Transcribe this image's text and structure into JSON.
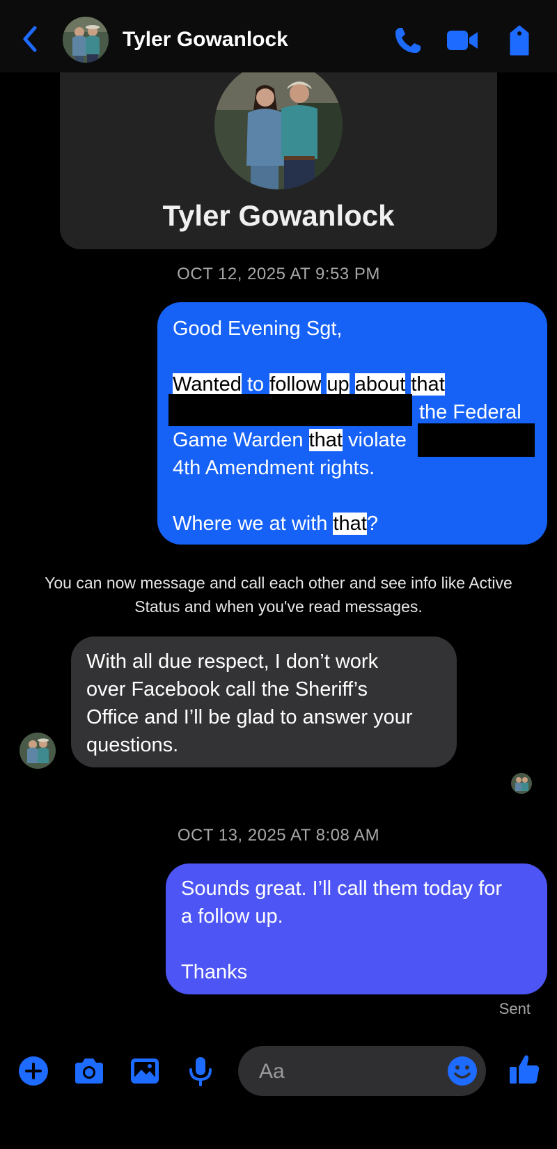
{
  "header": {
    "contact_name": "Tyler Gowanlock",
    "icons": [
      "back-chevron-icon",
      "phone-icon",
      "video-camera-icon",
      "tag-icon"
    ]
  },
  "profile": {
    "name": "Tyler Gowanlock"
  },
  "conversation": {
    "timestamp1": "OCT 12, 2025 AT 9:53 PM",
    "message1": {
      "greeting": "Good Evening Sgt,",
      "l2": [
        "Wanted",
        "to",
        "follow",
        "up",
        "about",
        "that"
      ],
      "l3_visible": "the Federal",
      "l4_a": "Game Warden",
      "l4_hl": "that",
      "l4_b": "violate",
      "l5": "4th Amendment rights.",
      "l6_a": "Where we at with",
      "l6_hl": "that",
      "l6_b": "?"
    },
    "info_line1": "You can now message and call each other and see info like Active",
    "info_line2": "Status and when you've read messages.",
    "message2": {
      "l1": "With all due respect, I don’t work",
      "l2": "over Facebook call the Sheriff’s",
      "l3": "Office and I’ll be glad to answer your",
      "l4": "questions."
    },
    "timestamp2": "OCT 13, 2025 AT 8:08 AM",
    "message3": {
      "l1": "Sounds great. I’ll call them today for",
      "l2": "a follow up.",
      "l3": "Thanks"
    },
    "status": "Sent"
  },
  "composer": {
    "placeholder": "Aa",
    "icons": [
      "plus-icon",
      "camera-icon",
      "gallery-icon",
      "microphone-icon",
      "emoji-icon",
      "thumbs-up-icon"
    ]
  },
  "colors": {
    "accent": "#1e6bff",
    "outgoing_bubble": "#1662f7",
    "outgoing_bubble_latest": "#4d55f5",
    "incoming_bubble": "#333335",
    "background": "#000000"
  }
}
